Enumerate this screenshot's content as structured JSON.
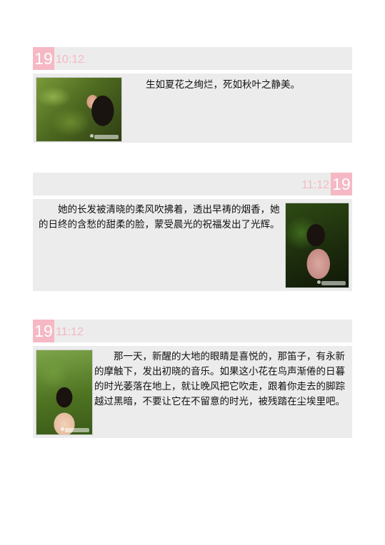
{
  "entries": [
    {
      "day": "19",
      "time": "10:12",
      "text": "生如夏花之绚烂，死如秋叶之静美。"
    },
    {
      "day": "19",
      "time": "11:12",
      "text": "　　她的长发被清晓的柔风吹拂着，透出早祷的烟香，她的日终的含愁的甜柔的脸，蒙受晨光的祝福发出了光辉。"
    },
    {
      "day": "19",
      "time": "11:12",
      "text": "　　那一天，新醒的大地的眼睛是喜悦的，那笛子，有永新的摩触下，发出初晓的音乐。如果这小花在鸟声渐倦的日暮的时光萎落在地上，就让晚风把它吹走，跟着你走去的脚踪越过黑暗，不要让它在不留意的时光，被残踏在尘埃里吧。"
    }
  ],
  "colors": {
    "accent_pink": "#f5b8c4",
    "panel_gray": "#ececec",
    "text": "#111111"
  }
}
